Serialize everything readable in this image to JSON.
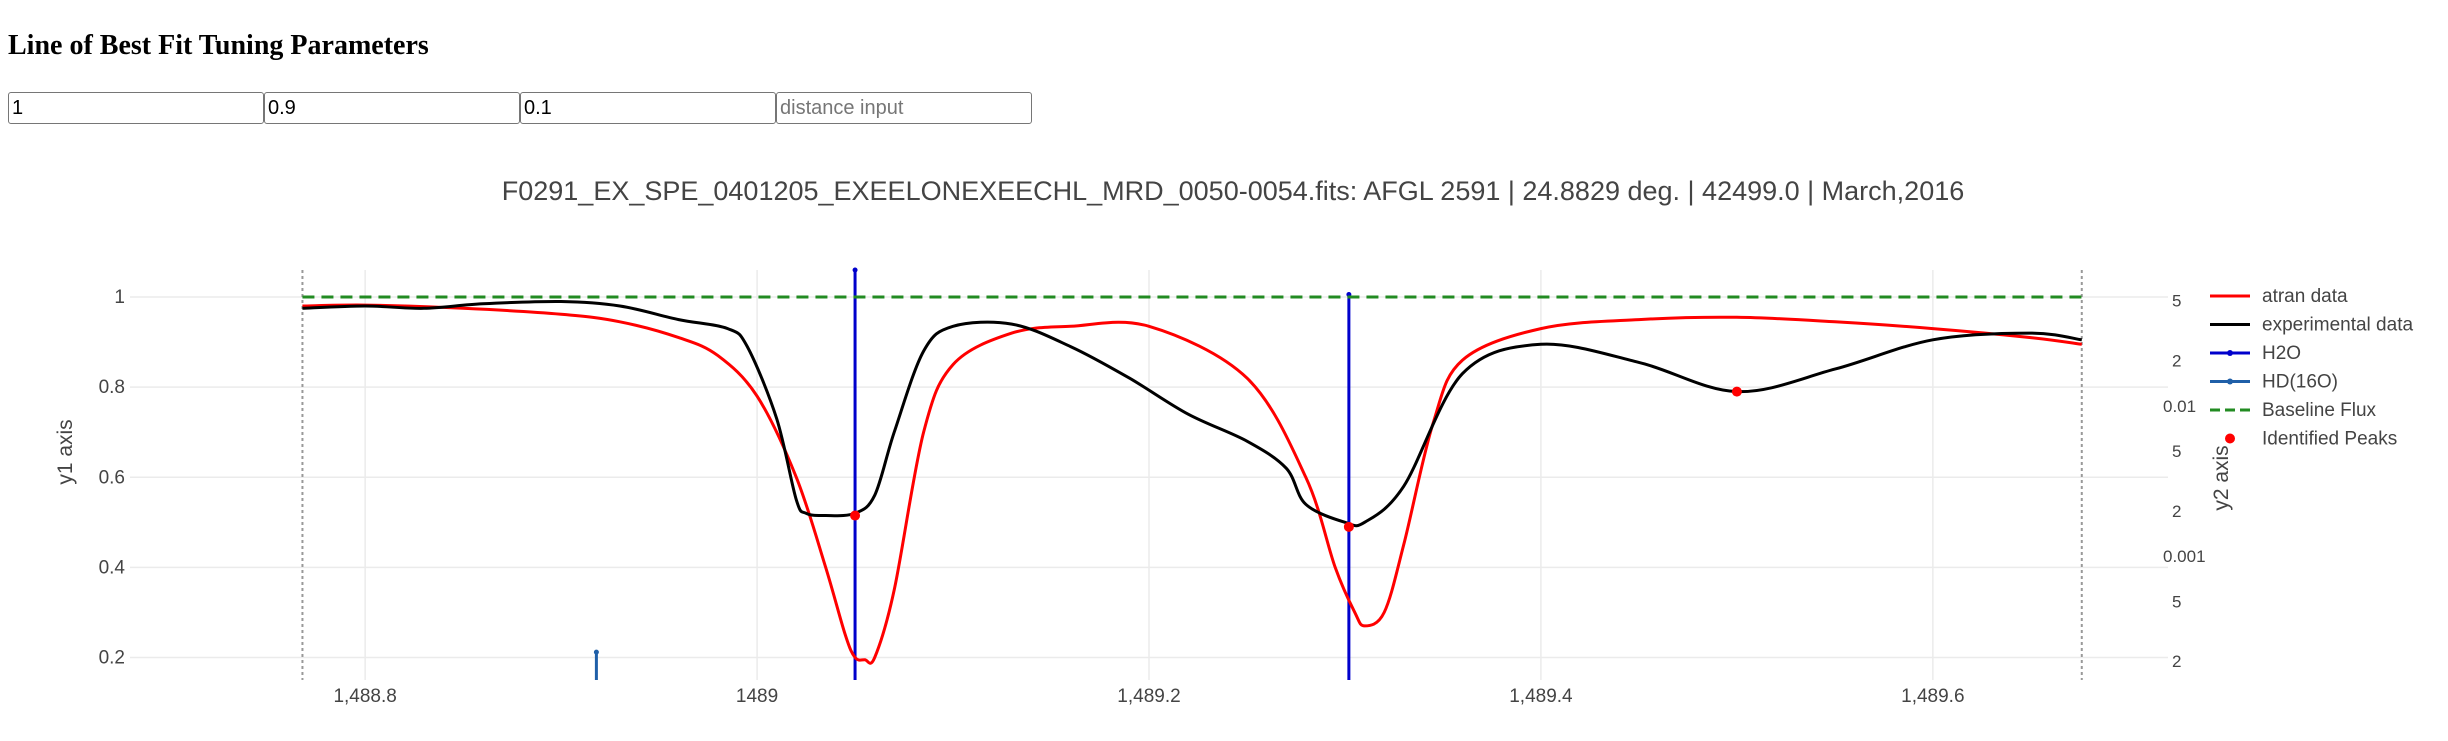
{
  "page": {
    "heading": "Line of Best Fit Tuning Parameters",
    "inputs": [
      {
        "value": "1",
        "placeholder": ""
      },
      {
        "value": "0.9",
        "placeholder": ""
      },
      {
        "value": "0.1",
        "placeholder": ""
      },
      {
        "value": "",
        "placeholder": "distance input"
      }
    ]
  },
  "chart_data": {
    "type": "line",
    "title": "F0291_EX_SPE_0401205_EXEELONEXEECHL_MRD_0050-0054.fits:  AFGL 2591 | 24.8829 deg. | 42499.0 | March,2016",
    "xlabel": "",
    "ylabel": "y1 axis",
    "y2label": "y2 axis",
    "xlim": [
      1488.68,
      1489.72
    ],
    "ylim": [
      0.15,
      1.06
    ],
    "y2_scale": "log",
    "y2lim": [
      0.00015,
      0.08
    ],
    "x_ticks": [
      1488.8,
      1489,
      1489.2,
      1489.4,
      1489.6
    ],
    "x_tick_labels": [
      "1,488.8",
      "1489",
      "1,489.2",
      "1,489.4",
      "1,489.6"
    ],
    "y_ticks": [
      0.2,
      0.4,
      0.6,
      0.8,
      1
    ],
    "y_tick_labels": [
      "0.2",
      "0.4",
      "0.6",
      "0.8",
      "1"
    ],
    "y2_ticks": [
      0.0002,
      0.0005,
      0.001,
      0.002,
      0.005,
      0.01,
      0.02,
      0.05
    ],
    "y2_tick_labels": [
      "2",
      "5",
      "0.001",
      "2",
      "5",
      "0.01",
      "2",
      "5"
    ],
    "grid": true,
    "legend_position": "right",
    "series": [
      {
        "name": "atran data",
        "color": "#ff0000",
        "style": "solid",
        "axis": "y1",
        "x": [
          1488.768,
          1488.8,
          1488.85,
          1488.9,
          1488.93,
          1488.96,
          1488.98,
          1489.0,
          1489.02,
          1489.035,
          1489.045,
          1489.05,
          1489.055,
          1489.06,
          1489.07,
          1489.085,
          1489.1,
          1489.13,
          1489.16,
          1489.2,
          1489.25,
          1489.28,
          1489.295,
          1489.305,
          1489.31,
          1489.32,
          1489.33,
          1489.345,
          1489.36,
          1489.4,
          1489.45,
          1489.5,
          1489.55,
          1489.6,
          1489.65,
          1489.676
        ],
        "y": [
          0.98,
          0.982,
          0.975,
          0.962,
          0.945,
          0.91,
          0.87,
          0.78,
          0.6,
          0.4,
          0.25,
          0.2,
          0.195,
          0.2,
          0.35,
          0.7,
          0.85,
          0.92,
          0.935,
          0.935,
          0.82,
          0.6,
          0.4,
          0.3,
          0.27,
          0.3,
          0.45,
          0.72,
          0.86,
          0.93,
          0.95,
          0.955,
          0.945,
          0.93,
          0.91,
          0.895
        ]
      },
      {
        "name": "experimental data",
        "color": "#000000",
        "style": "solid",
        "axis": "y1",
        "x": [
          1488.768,
          1488.8,
          1488.83,
          1488.86,
          1488.9,
          1488.93,
          1488.96,
          1488.985,
          1488.995,
          1489.01,
          1489.02,
          1489.025,
          1489.035,
          1489.05,
          1489.06,
          1489.07,
          1489.085,
          1489.1,
          1489.13,
          1489.16,
          1489.19,
          1489.22,
          1489.25,
          1489.27,
          1489.28,
          1489.3,
          1489.31,
          1489.33,
          1489.36,
          1489.4,
          1489.45,
          1489.5,
          1489.55,
          1489.6,
          1489.65,
          1489.676
        ],
        "y": [
          0.975,
          0.98,
          0.975,
          0.985,
          0.99,
          0.98,
          0.95,
          0.93,
          0.89,
          0.73,
          0.55,
          0.52,
          0.515,
          0.52,
          0.56,
          0.7,
          0.88,
          0.935,
          0.94,
          0.89,
          0.82,
          0.74,
          0.68,
          0.62,
          0.54,
          0.5,
          0.5,
          0.58,
          0.83,
          0.895,
          0.855,
          0.79,
          0.84,
          0.905,
          0.92,
          0.905
        ]
      },
      {
        "name": "H2O",
        "color": "#0000cc",
        "style": "sticks",
        "axis": "y2",
        "x": [
          1489.05,
          1489.302
        ],
        "y": [
          0.08,
          0.055
        ]
      },
      {
        "name": "HD(16O)",
        "color": "#1f5fa8",
        "style": "sticks",
        "axis": "y2",
        "x": [
          1488.918
        ],
        "y": [
          0.00023
        ]
      },
      {
        "name": "Baseline Flux",
        "color": "#228b22",
        "style": "dashed",
        "axis": "y1",
        "x": [
          1488.768,
          1489.676
        ],
        "y": [
          1.0,
          1.0
        ]
      },
      {
        "name": "Identified Peaks",
        "color": "#ff0000",
        "style": "markers",
        "axis": "y1",
        "x": [
          1489.05,
          1489.302,
          1489.5
        ],
        "y": [
          0.515,
          0.49,
          0.79
        ]
      }
    ],
    "vlines": [
      1488.768,
      1489.676
    ]
  }
}
